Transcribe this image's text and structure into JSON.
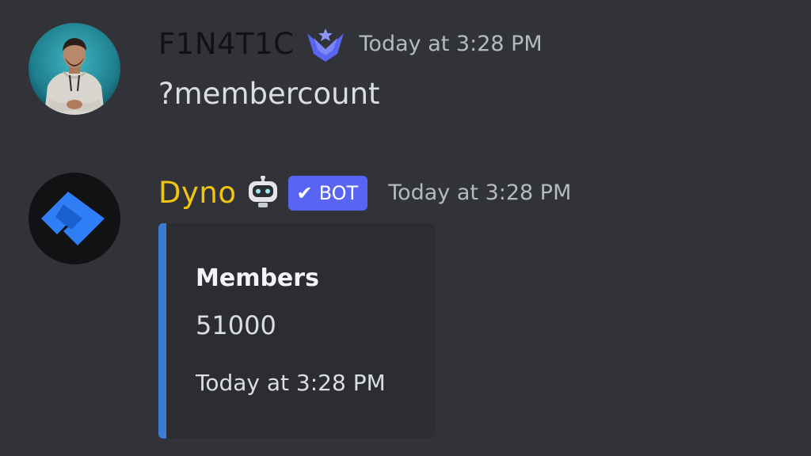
{
  "colors": {
    "background": "#313338",
    "user1_name": "#111214",
    "bot_name": "#f1c40f",
    "bot_tag": "#5865f2",
    "embed_bar": "#3a7bd5",
    "embed_bg": "#2b2d31",
    "timestamp": "#b5bac1"
  },
  "messages": [
    {
      "username": "F1N4T1C",
      "avatar_icon": "user-photo-avatar",
      "badge_icon": "server-booster-wings-icon",
      "timestamp": "Today at 3:28 PM",
      "content": "?membercount"
    },
    {
      "username": "Dyno",
      "avatar_icon": "dyno-logo-avatar",
      "badge_icon": "robot-face-icon",
      "bot_tag": "BOT",
      "bot_tag_icon": "checkmark-icon",
      "timestamp": "Today at 3:28 PM",
      "embed": {
        "field_name": "Members",
        "field_value": "51000",
        "footer": "Today at 3:28 PM"
      }
    }
  ]
}
